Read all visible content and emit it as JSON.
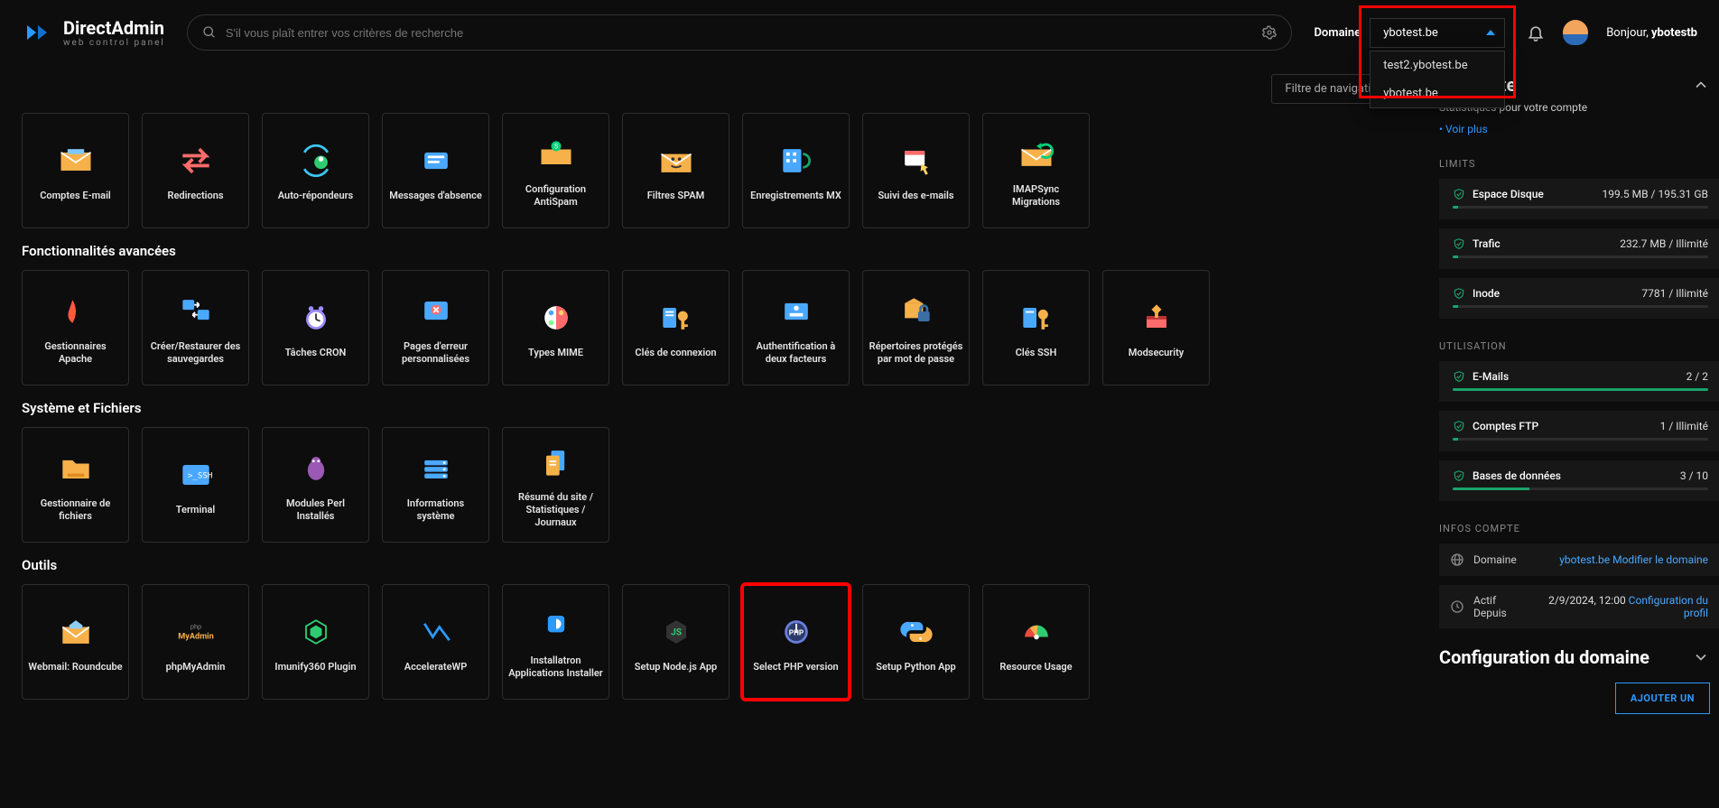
{
  "header": {
    "brand_title": "DirectAdmin",
    "brand_subtitle": "web control panel",
    "search_placeholder": "S'il vous plaît entrer vos critères de recherche",
    "domain_label": "Domaine",
    "domain_selected": "ybotest.be",
    "domain_options": [
      "test2.ybotest.be",
      "ybotest.be"
    ],
    "greeting_prefix": "Bonjour, ",
    "greeting_user": "ybotestb"
  },
  "filter_label": "Filtre de navigation",
  "sections": {
    "email": {
      "title": ""
    },
    "advanced": {
      "title": "Fonctionnalités avancées"
    },
    "system": {
      "title": "Système et Fichiers"
    },
    "tools": {
      "title": "Outils"
    }
  },
  "tiles_email": [
    {
      "label": "Comptes E-mail",
      "icon": "mail",
      "colors": [
        "#f7b14a",
        "#f0932b"
      ]
    },
    {
      "label": "Redirections",
      "icon": "redirect",
      "colors": [
        "#ff6b6b"
      ]
    },
    {
      "label": "Auto-répondeurs",
      "icon": "autoresponder",
      "colors": [
        "#3ec5f1",
        "#2ecc71"
      ]
    },
    {
      "label": "Messages d'absence",
      "icon": "vacation",
      "colors": [
        "#4aa8ff"
      ]
    },
    {
      "label": "Configuration AntiSpam",
      "icon": "antispam",
      "colors": [
        "#f7b14a",
        "#00d27a"
      ]
    },
    {
      "label": "Filtres SPAM",
      "icon": "spamfilter",
      "colors": [
        "#f7b14a"
      ]
    },
    {
      "label": "Enregistrements MX",
      "icon": "mx",
      "colors": [
        "#4aa8ff"
      ]
    },
    {
      "label": "Suivi des e-mails",
      "icon": "track",
      "colors": [
        "#ff6b6b",
        "#ffd166"
      ]
    },
    {
      "label": "IMAPSync Migrations",
      "icon": "imapsync",
      "colors": [
        "#f7b14a",
        "#00d27a"
      ]
    }
  ],
  "tiles_advanced": [
    {
      "label": "Gestionnaires Apache",
      "icon": "apache",
      "colors": [
        "#ff5a3c"
      ]
    },
    {
      "label": "Créer/Restaurer des sauvegardes",
      "icon": "backup",
      "colors": [
        "#4aa8ff"
      ]
    },
    {
      "label": "Tâches CRON",
      "icon": "cron",
      "colors": [
        "#9b8cff"
      ]
    },
    {
      "label": "Pages d'erreur personnalisées",
      "icon": "errorpage",
      "colors": [
        "#4aa8ff",
        "#ff6b6b"
      ]
    },
    {
      "label": "Types MIME",
      "icon": "mime",
      "colors": [
        "#ff6b6b",
        "#4aa8ff",
        "#ffd166",
        "#7cfc8c"
      ]
    },
    {
      "label": "Clés de connexion",
      "icon": "loginkey",
      "colors": [
        "#4aa8ff",
        "#f7b14a"
      ]
    },
    {
      "label": "Authentification à deux facteurs",
      "icon": "2fa",
      "colors": [
        "#4aa8ff"
      ]
    },
    {
      "label": "Répertoires protégés par mot de passe",
      "icon": "protected",
      "colors": [
        "#f7b14a",
        "#3b6ea5"
      ]
    },
    {
      "label": "Clés SSH",
      "icon": "sshkey",
      "colors": [
        "#4aa8ff",
        "#f7b14a"
      ]
    },
    {
      "label": "Modsecurity",
      "icon": "modsec",
      "colors": [
        "#ff6b6b",
        "#f7b14a"
      ]
    }
  ],
  "tiles_system": [
    {
      "label": "Gestionnaire de fichiers",
      "icon": "files",
      "colors": [
        "#f7b14a"
      ]
    },
    {
      "label": "Terminal",
      "icon": "terminal",
      "colors": [
        "#4aa8ff"
      ]
    },
    {
      "label": "Modules Perl Installés",
      "icon": "perl",
      "colors": [
        "#9b59b6"
      ]
    },
    {
      "label": "Informations système",
      "icon": "sysinfo",
      "colors": [
        "#4aa8ff"
      ]
    },
    {
      "label": "Résumé du site / Statistiques / Journaux",
      "icon": "stats",
      "colors": [
        "#4aa8ff",
        "#f7b14a"
      ]
    }
  ],
  "tiles_tools": [
    {
      "label": "Webmail: Roundcube",
      "icon": "roundcube",
      "colors": [
        "#90cdf4",
        "#f7b14a"
      ]
    },
    {
      "label": "phpMyAdmin",
      "icon": "phpmyadmin",
      "colors": [
        "#f7b14a"
      ]
    },
    {
      "label": "Imunify360 Plugin",
      "icon": "imunify",
      "colors": [
        "#2ecc71"
      ]
    },
    {
      "label": "AccelerateWP",
      "icon": "acceleratewp",
      "colors": [
        "#2b9aff"
      ]
    },
    {
      "label": "Installatron Applications Installer",
      "icon": "installatron",
      "colors": [
        "#2b9aff"
      ]
    },
    {
      "label": "Setup Node.js App",
      "icon": "nodejs",
      "colors": [
        "#2ecc71"
      ]
    },
    {
      "label": "Select PHP version",
      "icon": "php",
      "colors": [
        "#6a7fdb"
      ],
      "highlighted": true
    },
    {
      "label": "Setup Python App",
      "icon": "python",
      "colors": [
        "#4aa8ff",
        "#f7b14a"
      ]
    },
    {
      "label": "Resource Usage",
      "icon": "resource",
      "colors": [
        "#e74c3c",
        "#f7b14a",
        "#2ecc71"
      ]
    }
  ],
  "sidebar": {
    "account_title": "…Compte",
    "account_sub": "Statistiques pour votre compte",
    "see_more": "Voir plus",
    "limits_title": "LIMITS",
    "limits": [
      {
        "name": "Espace Disque",
        "value": "199.5 MB / 195.31 GB",
        "pct": 1
      },
      {
        "name": "Trafic",
        "value": "232.7 MB / Illimité",
        "pct": 2
      },
      {
        "name": "Inode",
        "value": "7781 / Illimité",
        "pct": 2
      }
    ],
    "usage_title": "UTILISATION",
    "usage": [
      {
        "name": "E-Mails",
        "value": "2 / 2",
        "pct": 100
      },
      {
        "name": "Comptes FTP",
        "value": "1 / Illimité",
        "pct": 2
      },
      {
        "name": "Bases de données",
        "value": "3 / 10",
        "pct": 30
      }
    ],
    "info_title": "INFOS COMPTE",
    "info_domain_label": "Domaine",
    "info_domain_value": "ybotest.be",
    "info_domain_action": "Modifier le domaine",
    "info_active_label": "Actif Depuis",
    "info_active_value": "2/9/2024, 12:00",
    "info_profile_action": "Configuration du profil",
    "domain_config_title": "Configuration du domaine",
    "add_button": "AJOUTER UN"
  }
}
